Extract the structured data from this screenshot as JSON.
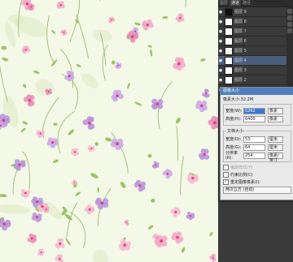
{
  "panel": {
    "tabs": [
      "图层",
      "通道",
      "路径"
    ],
    "layers": [
      {
        "name": "图层 9",
        "thumb": "#111111",
        "selected": false
      },
      {
        "name": "图层 8",
        "thumb": "#ffffff",
        "selected": false
      },
      {
        "name": "图层 7",
        "thumb": "#ffffff",
        "selected": false
      },
      {
        "name": "图层 6",
        "thumb": "#ffffff",
        "selected": false
      },
      {
        "name": "图层 5",
        "thumb": "#f4f4f4",
        "selected": false
      },
      {
        "name": "图层 4",
        "thumb": "#ffffff",
        "selected": true
      },
      {
        "name": "图层 3",
        "thumb": "#ffffff",
        "selected": false
      },
      {
        "name": "图层 2",
        "thumb": "#ffffff",
        "selected": false
      },
      {
        "name": "图层 1",
        "thumb": "#ffffff",
        "selected": false
      }
    ]
  },
  "dialog": {
    "title": "图像大小",
    "size_text": "像素大小:32.2M",
    "pixel": {
      "title": "像素大小",
      "width_label": "宽度(W):",
      "width_value": "5262",
      "width_unit": "像素",
      "height_label": "高度(H):",
      "height_value": "6400",
      "height_unit": "像素"
    },
    "doc": {
      "title": "文档大小:",
      "width_label": "宽度(D):",
      "width_value": "53",
      "width_unit": "厘米",
      "height_label": "高度(G):",
      "height_value": "64",
      "height_unit": "厘米",
      "res_label": "分辨率(R):",
      "res_value": "254",
      "res_unit": "像素/英寸"
    },
    "scale_styles": "缩放样式(Y)",
    "constrain": "约束比例(C)",
    "resample": "重定图像像素(I):",
    "method": "两次立方 (自动)"
  }
}
